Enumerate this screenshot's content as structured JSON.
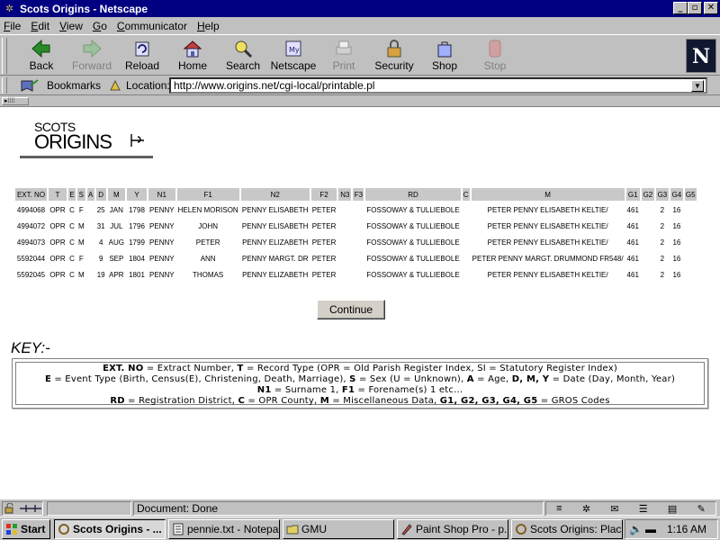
{
  "window": {
    "title": "Scots Origins - Netscape",
    "buttons": {
      "minimize": "_",
      "maximize": "▫",
      "close": "✕"
    }
  },
  "menu": [
    "File",
    "Edit",
    "View",
    "Go",
    "Communicator",
    "Help"
  ],
  "toolbar": {
    "buttons": [
      {
        "label": "Back",
        "icon": "back-arrow-icon",
        "enabled": true
      },
      {
        "label": "Forward",
        "icon": "forward-arrow-icon",
        "enabled": false
      },
      {
        "label": "Reload",
        "icon": "reload-icon",
        "enabled": true
      },
      {
        "label": "Home",
        "icon": "home-icon",
        "enabled": true
      },
      {
        "label": "Search",
        "icon": "search-icon",
        "enabled": true
      },
      {
        "label": "Netscape",
        "icon": "netscape-icon",
        "enabled": true
      },
      {
        "label": "Print",
        "icon": "print-icon",
        "enabled": false
      },
      {
        "label": "Security",
        "icon": "lock-icon",
        "enabled": true
      },
      {
        "label": "Shop",
        "icon": "shop-icon",
        "enabled": true
      },
      {
        "label": "Stop",
        "icon": "stop-icon",
        "enabled": false
      }
    ],
    "logo": "N"
  },
  "location": {
    "bookmarks_label": "Bookmarks",
    "location_label": "Location:",
    "url": "http://www.origins.net/cgi-local/printable.pl"
  },
  "page": {
    "logo_line1": "SCOTS",
    "logo_line2": "ORIGINS",
    "table": {
      "headers": [
        "EXT. NO",
        "T",
        "E",
        "S",
        "A",
        "D",
        "M",
        "Y",
        "N1",
        "F1",
        "N2",
        "F2",
        "N3",
        "F3",
        "RD",
        "C",
        "M",
        "G1",
        "G2",
        "G3",
        "G4",
        "G5"
      ],
      "rows": [
        [
          "4994068",
          "OPR",
          "C",
          "F",
          "",
          "25",
          "JAN",
          "1798",
          "PENNY",
          "HELEN MORISON",
          "PENNY ELISABETH",
          "PETER",
          "",
          "",
          "FOSSOWAY & TULLIEBOLE",
          "",
          "PETER PENNY ELISABETH KELTIE/",
          "461",
          "",
          "2",
          "16",
          ""
        ],
        [
          "4994072",
          "OPR",
          "C",
          "M",
          "",
          "31",
          "JUL",
          "1796",
          "PENNY",
          "JOHN",
          "PENNY ELISABETH",
          "PETER",
          "",
          "",
          "FOSSOWAY & TULLIEBOLE",
          "",
          "PETER PENNY ELISABETH KELTIE/",
          "461",
          "",
          "2",
          "16",
          ""
        ],
        [
          "4994073",
          "OPR",
          "C",
          "M",
          "",
          "4",
          "AUG",
          "1799",
          "PENNY",
          "PETER",
          "PENNY ELIZABETH",
          "PETER",
          "",
          "",
          "FOSSOWAY & TULLIEBOLE",
          "",
          "PETER PENNY ELISABETH KELTIE/",
          "461",
          "",
          "2",
          "16",
          ""
        ],
        [
          "5592044",
          "OPR",
          "C",
          "F",
          "",
          "9",
          "SEP",
          "1804",
          "PENNY",
          "ANN",
          "PENNY MARGT. DR",
          "PETER",
          "",
          "",
          "FOSSOWAY & TULLIEBOLE",
          "",
          "PETER PENNY MARGT. DRUMMOND FR548/",
          "461",
          "",
          "2",
          "16",
          ""
        ],
        [
          "5592045",
          "OPR",
          "C",
          "M",
          "",
          "19",
          "APR",
          "1801",
          "PENNY",
          "THOMAS",
          "PENNY ELIZABETH",
          "PETER",
          "",
          "",
          "FOSSOWAY & TULLIEBOLE",
          "",
          "PETER PENNY ELISABETH KELTIE/",
          "461",
          "",
          "2",
          "16",
          ""
        ]
      ]
    },
    "continue_label": "Continue",
    "key_heading": "KEY:-",
    "key_lines": [
      [
        {
          "b": "EXT. NO"
        },
        {
          "t": " = Extract Number, "
        },
        {
          "b": "T"
        },
        {
          "t": " = Record Type (OPR = Old Parish Register Index, SI = Statutory Register Index)"
        }
      ],
      [
        {
          "b": "E"
        },
        {
          "t": " = Event Type (Birth, Census(E), Christening, Death, Marriage), "
        },
        {
          "b": "S"
        },
        {
          "t": " = Sex (U = Unknown), "
        },
        {
          "b": "A"
        },
        {
          "t": " = Age, "
        },
        {
          "b": "D, M, Y"
        },
        {
          "t": " = Date (Day, Month, Year)"
        }
      ],
      [
        {
          "b": "N1"
        },
        {
          "t": " = Surname 1, "
        },
        {
          "b": "F1"
        },
        {
          "t": " = Forename(s) 1 etc..."
        }
      ],
      [
        {
          "b": "RD"
        },
        {
          "t": " = Registration District, "
        },
        {
          "b": "C"
        },
        {
          "t": " = OPR County, "
        },
        {
          "b": "M"
        },
        {
          "t": " = Miscellaneous Data, "
        },
        {
          "b": "G1, G2, G3, G4, G5"
        },
        {
          "t": " = GROS Codes"
        }
      ]
    ]
  },
  "status": {
    "text": "Document: Done"
  },
  "taskbar": {
    "start": "Start",
    "items": [
      {
        "label": "Scots Origins - ...",
        "icon": "netscape-icon",
        "active": true
      },
      {
        "label": "pennie.txt - Notepad",
        "icon": "notepad-icon",
        "active": false
      },
      {
        "label": "GMU",
        "icon": "folder-icon",
        "active": false
      },
      {
        "label": "Paint Shop Pro - p...",
        "icon": "paint-icon",
        "active": false
      },
      {
        "label": "Scots Origins: Plac...",
        "icon": "netscape-icon",
        "active": false
      }
    ],
    "clock": "1:16 AM"
  }
}
